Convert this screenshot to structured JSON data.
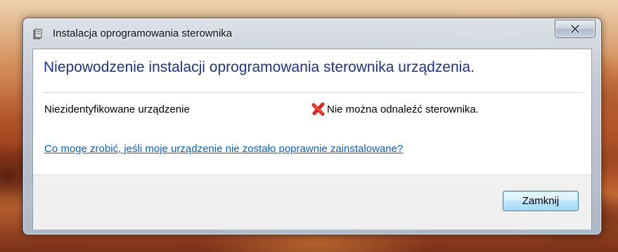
{
  "window": {
    "title": "Instalacja oprogramowania sterownika",
    "close_glyph": "x"
  },
  "content": {
    "heading": "Niepowodzenie instalacji oprogramowania sterownika urządzenia.",
    "device": {
      "name": "Niezidentyfikowane urządzenie",
      "status": "Nie można odnaleźć sterownika.",
      "status_icon": "error-x-icon"
    },
    "help_link": "Co mogę zrobić, jeśli moje urządzenie nie zostało poprawnie zainstalowane?"
  },
  "footer": {
    "close_button": "Zamknij"
  },
  "colors": {
    "heading": "#1e3287",
    "link": "#0a5fb8",
    "error": "#d9261c"
  }
}
